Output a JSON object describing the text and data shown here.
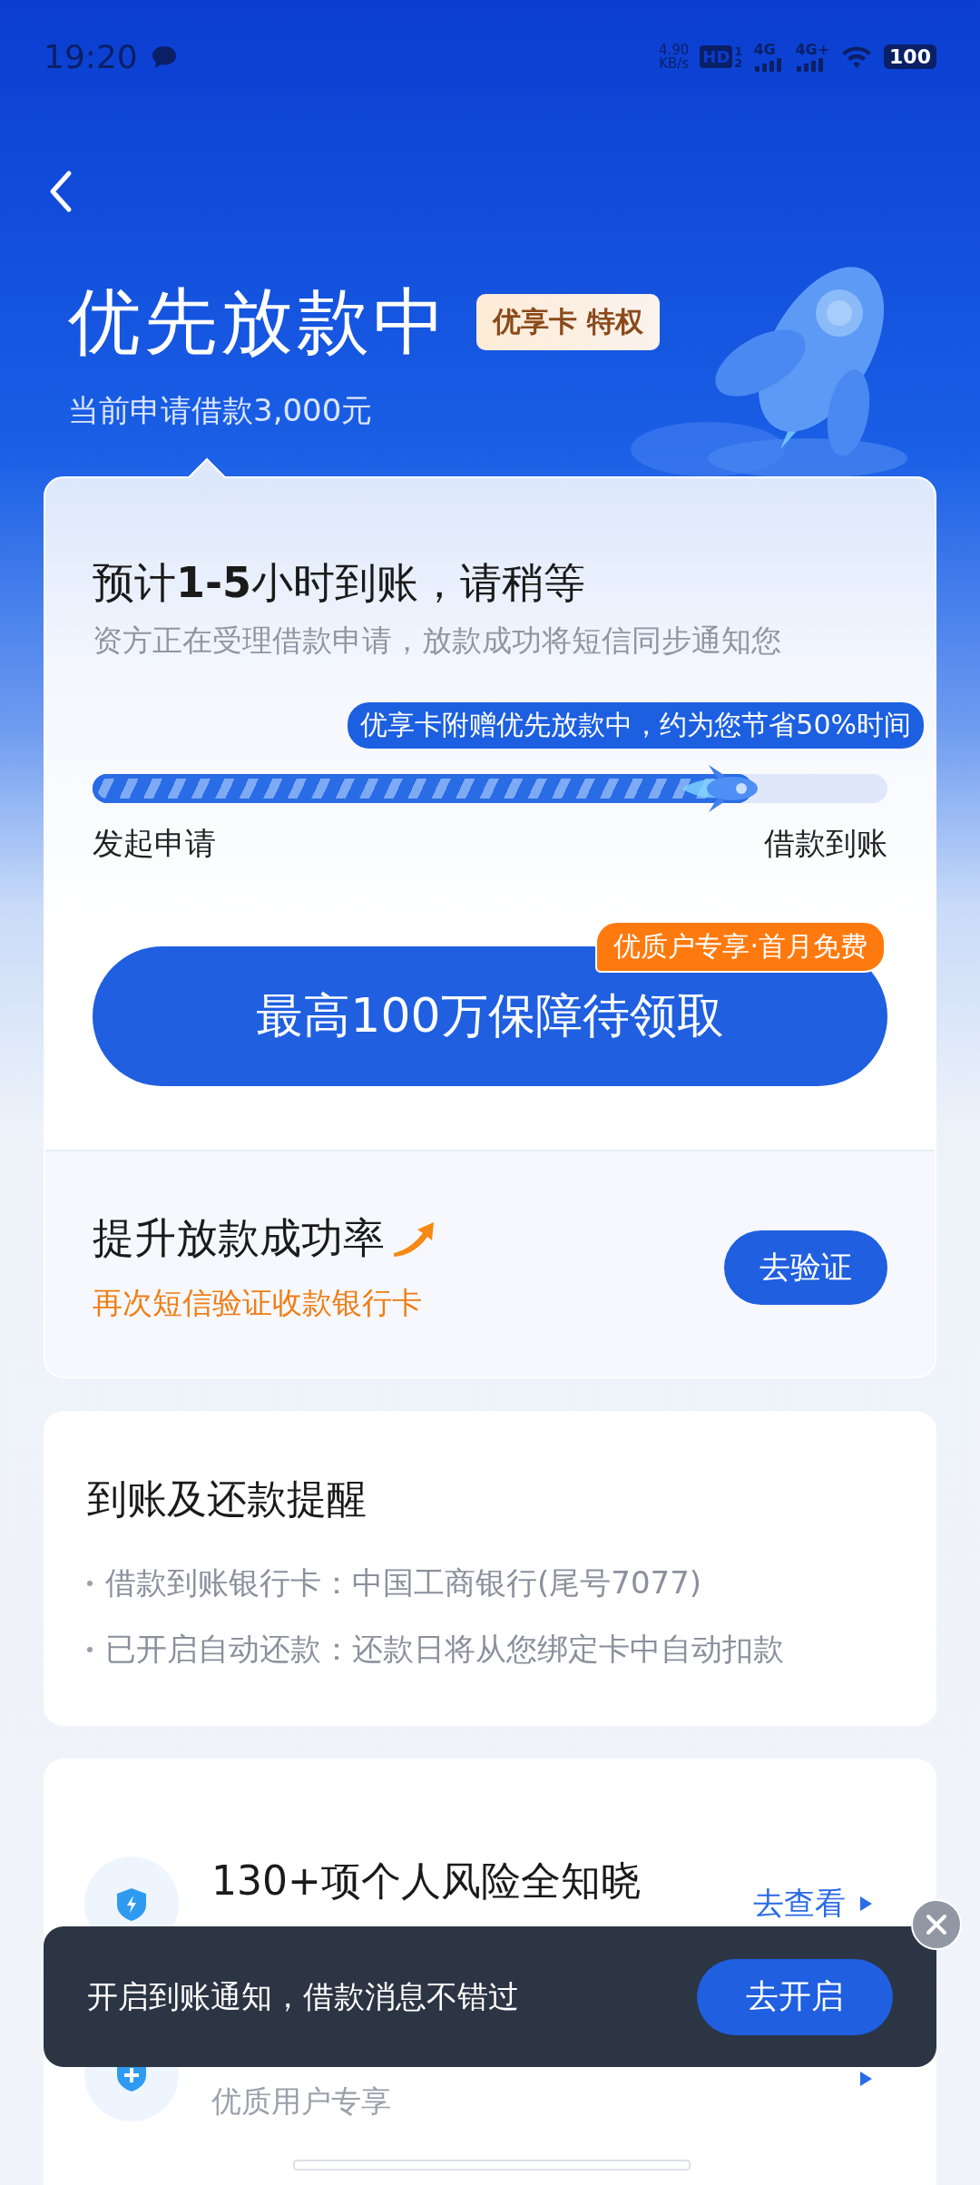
{
  "status_bar": {
    "time": "19:20",
    "net_speed": "4.90",
    "net_unit": "KB/s",
    "hd": "HD",
    "sim_1": "1",
    "sim_2": "2",
    "network_1": "4G",
    "network_2": "4G+",
    "battery": "100"
  },
  "header": {
    "title": "优先放款中",
    "badge": "优享卡 特权",
    "subtitle": "当前申请借款3,000元"
  },
  "progress_card": {
    "title": "预计**1-5**小时到账，请稍等",
    "description": "资方正在受理借款申请，放款成功将短信同步通知您",
    "tooltip": "优享卡附赠优先放款中，约为您节省50%时间",
    "progress": {
      "level": 0.83
    },
    "start_label": "发起申请",
    "end_label": "借款到账",
    "claim_button": "最高100万保障待领取",
    "claim_badge": "优质户专享·首月免费",
    "boost": {
      "title": "提升放款成功率",
      "subtitle": "再次短信验证收款银行卡",
      "button": "去验证"
    }
  },
  "reminder_card": {
    "title": "到账及还款提醒",
    "items": [
      "借款到账银行卡：中国工商银行(尾号7077)",
      "已开启自动还款：还款日将从您绑定卡中自动扣款"
    ]
  },
  "services": [
    {
      "title": "130+项个人风险全知晓",
      "link": "去查看"
    },
    {
      "subtitle": "优质用户专享"
    }
  ],
  "toast": {
    "message": "开启到账通知，借款消息不错过",
    "button": "去开启"
  }
}
